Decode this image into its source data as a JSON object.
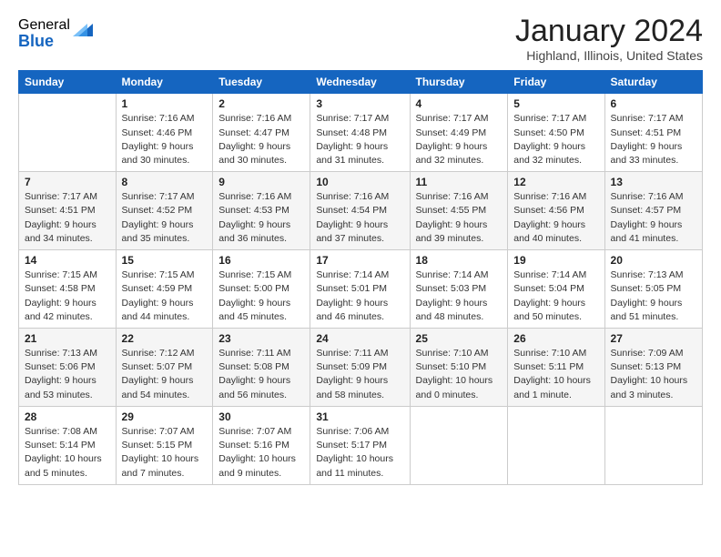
{
  "logo": {
    "general": "General",
    "blue": "Blue"
  },
  "title": "January 2024",
  "subtitle": "Highland, Illinois, United States",
  "days_of_week": [
    "Sunday",
    "Monday",
    "Tuesday",
    "Wednesday",
    "Thursday",
    "Friday",
    "Saturday"
  ],
  "weeks": [
    [
      {
        "day": "",
        "info": ""
      },
      {
        "day": "1",
        "info": "Sunrise: 7:16 AM\nSunset: 4:46 PM\nDaylight: 9 hours\nand 30 minutes."
      },
      {
        "day": "2",
        "info": "Sunrise: 7:16 AM\nSunset: 4:47 PM\nDaylight: 9 hours\nand 30 minutes."
      },
      {
        "day": "3",
        "info": "Sunrise: 7:17 AM\nSunset: 4:48 PM\nDaylight: 9 hours\nand 31 minutes."
      },
      {
        "day": "4",
        "info": "Sunrise: 7:17 AM\nSunset: 4:49 PM\nDaylight: 9 hours\nand 32 minutes."
      },
      {
        "day": "5",
        "info": "Sunrise: 7:17 AM\nSunset: 4:50 PM\nDaylight: 9 hours\nand 32 minutes."
      },
      {
        "day": "6",
        "info": "Sunrise: 7:17 AM\nSunset: 4:51 PM\nDaylight: 9 hours\nand 33 minutes."
      }
    ],
    [
      {
        "day": "7",
        "info": "Sunrise: 7:17 AM\nSunset: 4:51 PM\nDaylight: 9 hours\nand 34 minutes."
      },
      {
        "day": "8",
        "info": "Sunrise: 7:17 AM\nSunset: 4:52 PM\nDaylight: 9 hours\nand 35 minutes."
      },
      {
        "day": "9",
        "info": "Sunrise: 7:16 AM\nSunset: 4:53 PM\nDaylight: 9 hours\nand 36 minutes."
      },
      {
        "day": "10",
        "info": "Sunrise: 7:16 AM\nSunset: 4:54 PM\nDaylight: 9 hours\nand 37 minutes."
      },
      {
        "day": "11",
        "info": "Sunrise: 7:16 AM\nSunset: 4:55 PM\nDaylight: 9 hours\nand 39 minutes."
      },
      {
        "day": "12",
        "info": "Sunrise: 7:16 AM\nSunset: 4:56 PM\nDaylight: 9 hours\nand 40 minutes."
      },
      {
        "day": "13",
        "info": "Sunrise: 7:16 AM\nSunset: 4:57 PM\nDaylight: 9 hours\nand 41 minutes."
      }
    ],
    [
      {
        "day": "14",
        "info": "Sunrise: 7:15 AM\nSunset: 4:58 PM\nDaylight: 9 hours\nand 42 minutes."
      },
      {
        "day": "15",
        "info": "Sunrise: 7:15 AM\nSunset: 4:59 PM\nDaylight: 9 hours\nand 44 minutes."
      },
      {
        "day": "16",
        "info": "Sunrise: 7:15 AM\nSunset: 5:00 PM\nDaylight: 9 hours\nand 45 minutes."
      },
      {
        "day": "17",
        "info": "Sunrise: 7:14 AM\nSunset: 5:01 PM\nDaylight: 9 hours\nand 46 minutes."
      },
      {
        "day": "18",
        "info": "Sunrise: 7:14 AM\nSunset: 5:03 PM\nDaylight: 9 hours\nand 48 minutes."
      },
      {
        "day": "19",
        "info": "Sunrise: 7:14 AM\nSunset: 5:04 PM\nDaylight: 9 hours\nand 50 minutes."
      },
      {
        "day": "20",
        "info": "Sunrise: 7:13 AM\nSunset: 5:05 PM\nDaylight: 9 hours\nand 51 minutes."
      }
    ],
    [
      {
        "day": "21",
        "info": "Sunrise: 7:13 AM\nSunset: 5:06 PM\nDaylight: 9 hours\nand 53 minutes."
      },
      {
        "day": "22",
        "info": "Sunrise: 7:12 AM\nSunset: 5:07 PM\nDaylight: 9 hours\nand 54 minutes."
      },
      {
        "day": "23",
        "info": "Sunrise: 7:11 AM\nSunset: 5:08 PM\nDaylight: 9 hours\nand 56 minutes."
      },
      {
        "day": "24",
        "info": "Sunrise: 7:11 AM\nSunset: 5:09 PM\nDaylight: 9 hours\nand 58 minutes."
      },
      {
        "day": "25",
        "info": "Sunrise: 7:10 AM\nSunset: 5:10 PM\nDaylight: 10 hours\nand 0 minutes."
      },
      {
        "day": "26",
        "info": "Sunrise: 7:10 AM\nSunset: 5:11 PM\nDaylight: 10 hours\nand 1 minute."
      },
      {
        "day": "27",
        "info": "Sunrise: 7:09 AM\nSunset: 5:13 PM\nDaylight: 10 hours\nand 3 minutes."
      }
    ],
    [
      {
        "day": "28",
        "info": "Sunrise: 7:08 AM\nSunset: 5:14 PM\nDaylight: 10 hours\nand 5 minutes."
      },
      {
        "day": "29",
        "info": "Sunrise: 7:07 AM\nSunset: 5:15 PM\nDaylight: 10 hours\nand 7 minutes."
      },
      {
        "day": "30",
        "info": "Sunrise: 7:07 AM\nSunset: 5:16 PM\nDaylight: 10 hours\nand 9 minutes."
      },
      {
        "day": "31",
        "info": "Sunrise: 7:06 AM\nSunset: 5:17 PM\nDaylight: 10 hours\nand 11 minutes."
      },
      {
        "day": "",
        "info": ""
      },
      {
        "day": "",
        "info": ""
      },
      {
        "day": "",
        "info": ""
      }
    ]
  ]
}
